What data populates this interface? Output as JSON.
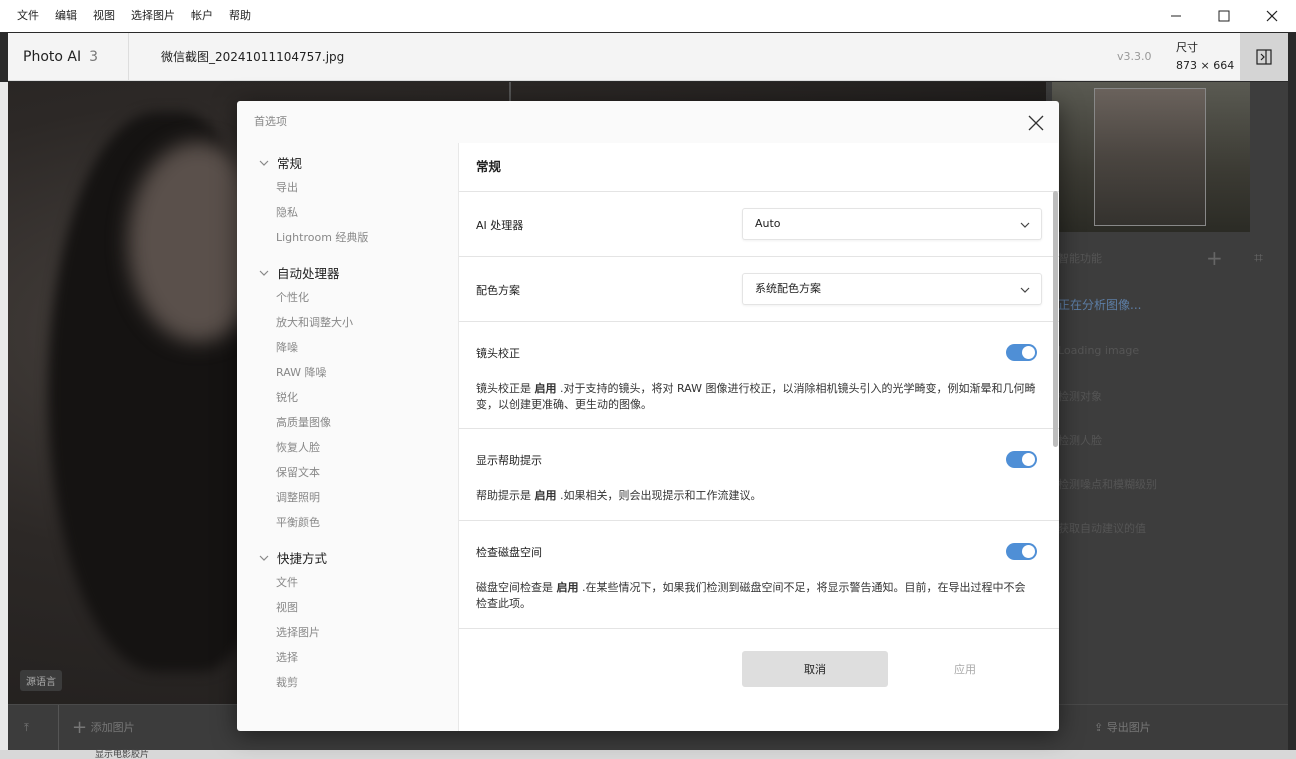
{
  "menubar": {
    "items": [
      "文件",
      "编辑",
      "视图",
      "选择图片",
      "帐户",
      "帮助"
    ]
  },
  "header": {
    "app_name": "Photo AI",
    "app_major": "3",
    "filename": "微信截图_20241011104757.jpg",
    "version": "v3.3.0",
    "size_label": "尺寸",
    "size_value": "873 × 664"
  },
  "canvas": {
    "lang_button": "源语言"
  },
  "right_panel": {
    "rows": [
      "智能功能",
      "正在分析图像...",
      "Loading image",
      "检测对象",
      "检测人脸",
      "检测噪点和模糊级别",
      "获取自动建议的值"
    ]
  },
  "bottombar": {
    "add_label": "添加图片",
    "export_label": "导出图片"
  },
  "bottomstrip": {
    "text": "显示电影胶片"
  },
  "dialog": {
    "title": "首选项",
    "sidebar": {
      "sections": [
        {
          "label": "常规",
          "items": [
            "导出",
            "隐私",
            "Lightroom 经典版"
          ]
        },
        {
          "label": "自动处理器",
          "items": [
            "个性化",
            "放大和调整大小",
            "降噪",
            "RAW 降噪",
            "锐化",
            "高质量图像",
            "恢复人脸",
            "保留文本",
            "调整照明",
            "平衡颜色"
          ]
        },
        {
          "label": "快捷方式",
          "items": [
            "文件",
            "视图",
            "选择图片",
            "选择",
            "裁剪"
          ]
        }
      ]
    },
    "content": {
      "title": "常规",
      "ai_processor": {
        "label": "AI 处理器",
        "value": "Auto"
      },
      "color_scheme": {
        "label": "配色方案",
        "value": "系统配色方案"
      },
      "lens_correction": {
        "label": "镜头校正",
        "enabled": true,
        "desc_pre": "镜头校正是 ",
        "desc_status": "启用",
        "desc_post": " .对于支持的镜头，将对 RAW 图像进行校正，以消除相机镜头引入的光学畸变，例如渐晕和几何畸变，以创建更准确、更生动的图像。"
      },
      "help_tips": {
        "label": "显示帮助提示",
        "enabled": true,
        "desc_pre": "帮助提示是 ",
        "desc_status": "启用",
        "desc_post": " .如果相关，则会出现提示和工作流建议。"
      },
      "disk_space": {
        "label": "检查磁盘空间",
        "enabled": true,
        "desc_pre": "磁盘空间检查是 ",
        "desc_status": "启用",
        "desc_post": " .在某些情况下，如果我们检测到磁盘空间不足，将显示警告通知。目前，在导出过程中不会检查此项。"
      },
      "cancel_label": "取消",
      "apply_label": "应用"
    }
  },
  "colors": {
    "accent": "#4f8fd6",
    "dialog_bg": "#fafafa"
  }
}
